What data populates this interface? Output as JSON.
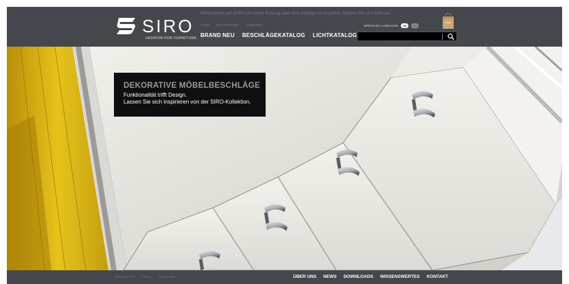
{
  "colors": {
    "header_bg": "#44474c",
    "promo_bg": "#0f0f10",
    "accent_yellow": "#e6c21a"
  },
  "logo": {
    "wordmark": "SIRO",
    "tagline": "FASHION FOR FURNITURE"
  },
  "header": {
    "welcome": "Willkommen bei SIRO! Um einen Katalog oder eine Anfrage zu erstellen, melden Sie sich bitte an.",
    "topnav": [
      "HOME",
      "REGISTRIEREN",
      "ANMELDEN"
    ],
    "mainnav": [
      "BRAND NEU",
      "BESCHLÄGEKATALOG",
      "LICHTKATALOG"
    ],
    "language_label": "SPRACHE | LANGUAGE",
    "languages": [
      "DE",
      "EN"
    ],
    "search": {
      "value": "",
      "icon": "magnifier-icon"
    },
    "cart_icon": "shopping-bag-icon"
  },
  "hero": {
    "title": "DEKORATIVE MÖBELBESCHLÄGE",
    "line1": "Funktionalität trifft Design.",
    "line2": "Lassen Sie sich inspirieren von der SIRO-Kollektion."
  },
  "footer": {
    "social": [
      "NEWSLETTER",
      "VIDEO",
      "FACEBOOK"
    ],
    "nav": [
      "ÜBER UNS",
      "NEWS",
      "DOWNLOADS",
      "WISSENSWERTES",
      "KONTAKT"
    ]
  }
}
